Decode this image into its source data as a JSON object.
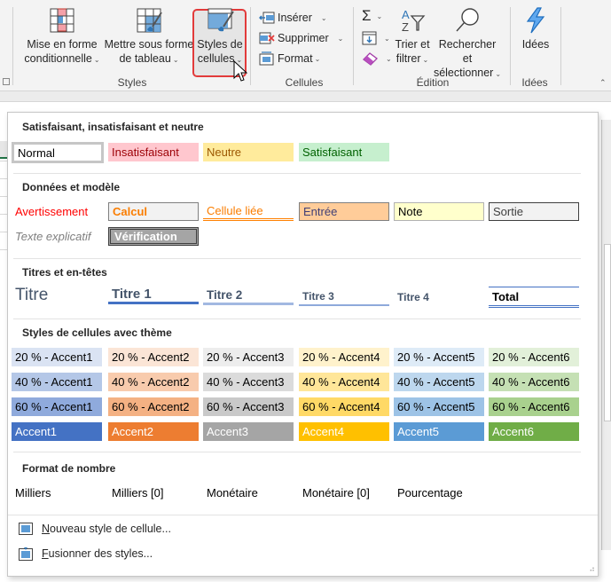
{
  "ribbon": {
    "groups": {
      "styles": {
        "label": "Styles",
        "conditional_formatting": {
          "line1": "Mise en forme",
          "line2": "conditionnelle"
        },
        "format_as_table": {
          "line1": "Mettre sous forme",
          "line2": "de tableau"
        },
        "cell_styles": {
          "line1": "Styles de",
          "line2": "cellules"
        }
      },
      "cells": {
        "label": "Cellules",
        "insert": "Insérer",
        "delete": "Supprimer",
        "format": "Format"
      },
      "editing": {
        "label": "Édition",
        "autosum_symbol": "Σ",
        "sort_filter": {
          "line1": "Trier et",
          "line2": "filtrer"
        },
        "find_select": {
          "line1": "Rechercher et",
          "line2": "sélectionner"
        }
      },
      "ideas": {
        "label": "Idées",
        "button": "Idées"
      }
    }
  },
  "gallery": {
    "sections": {
      "good_bad": {
        "title": "Satisfaisant, insatisfaisant et neutre",
        "items": [
          "Normal",
          "Insatisfaisant",
          "Neutre",
          "Satisfaisant"
        ]
      },
      "data_model": {
        "title": "Données et modèle",
        "row1": [
          "Avertissement",
          "Calcul",
          "Cellule liée",
          "Entrée",
          "Note",
          "Sortie"
        ],
        "row2": [
          "Texte explicatif",
          "Vérification"
        ]
      },
      "titles": {
        "title": "Titres et en-têtes",
        "items": [
          "Titre",
          "Titre 1",
          "Titre 2",
          "Titre 3",
          "Titre 4",
          "Total"
        ]
      },
      "themed": {
        "title": "Styles de cellules avec thème",
        "rows": [
          [
            "20 % - Accent1",
            "20 % - Accent2",
            "20 % - Accent3",
            "20 % - Accent4",
            "20 % - Accent5",
            "20 % - Accent6"
          ],
          [
            "40 % - Accent1",
            "40 % - Accent2",
            "40 % - Accent3",
            "40 % - Accent4",
            "40 % - Accent5",
            "40 % - Accent6"
          ],
          [
            "60 % - Accent1",
            "60 % - Accent2",
            "60 % - Accent3",
            "60 % - Accent4",
            "60 % - Accent5",
            "60 % - Accent6"
          ],
          [
            "Accent1",
            "Accent2",
            "Accent3",
            "Accent4",
            "Accent5",
            "Accent6"
          ]
        ],
        "colors": {
          "accent": [
            "#4472c4",
            "#ed7d31",
            "#a5a5a5",
            "#ffc000",
            "#5b9bd5",
            "#70ad47"
          ],
          "tint20": [
            "#dae3f3",
            "#fbe5d6",
            "#ededed",
            "#fff2cc",
            "#deebf7",
            "#e2f0d9"
          ],
          "tint40": [
            "#b4c7e7",
            "#f8cbad",
            "#dbdbdb",
            "#ffe699",
            "#bdd7ee",
            "#c5e0b4"
          ],
          "tint60": [
            "#8faadc",
            "#f4b183",
            "#c9c9c9",
            "#ffd966",
            "#9dc3e6",
            "#a9d18e"
          ]
        }
      },
      "number_format": {
        "title": "Format de nombre",
        "items": [
          "Milliers",
          "Milliers [0]",
          "Monétaire",
          "Monétaire [0]",
          "Pourcentage"
        ]
      }
    },
    "commands": {
      "new_style": {
        "accel": "N",
        "rest": "ouveau style de cellule..."
      },
      "merge_styles": {
        "accel": "F",
        "rest": "usionner des styles..."
      }
    }
  }
}
